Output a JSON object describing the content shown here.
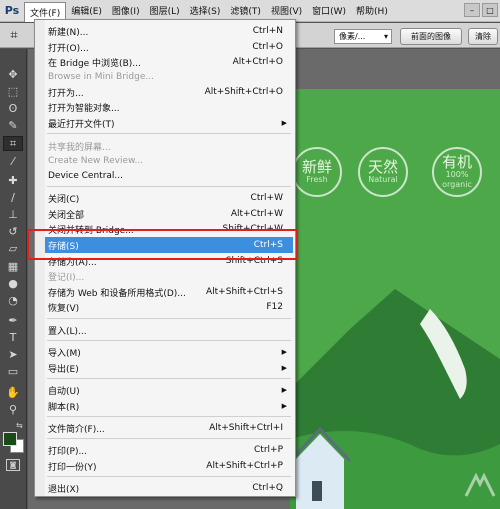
{
  "menubar": {
    "logo": "Ps",
    "items": [
      "文件(F)",
      "编辑(E)",
      "图像(I)",
      "图层(L)",
      "选择(S)",
      "滤镜(T)",
      "视图(V)",
      "窗口(W)",
      "帮助(H)"
    ],
    "active_index": 0
  },
  "options_bar": {
    "unit_value": "像素/...",
    "front_image_label": "前面的图像",
    "clear_label": "清除"
  },
  "file_menu": {
    "items": [
      {
        "label": "新建(N)...",
        "shortcut": "Ctrl+N",
        "enabled": true
      },
      {
        "label": "打开(O)...",
        "shortcut": "Ctrl+O",
        "enabled": true
      },
      {
        "label": "在 Bridge 中浏览(B)...",
        "shortcut": "Alt+Ctrl+O",
        "enabled": true
      },
      {
        "label": "Browse in Mini Bridge...",
        "shortcut": "",
        "enabled": false
      },
      {
        "label": "打开为...",
        "shortcut": "Alt+Shift+Ctrl+O",
        "enabled": true
      },
      {
        "label": "打开为智能对象...",
        "shortcut": "",
        "enabled": true
      },
      {
        "label": "最近打开文件(T)",
        "shortcut": "",
        "enabled": true,
        "submenu": true
      },
      {
        "label": "共享我的屏幕...",
        "shortcut": "",
        "enabled": false
      },
      {
        "label": "Create New Review...",
        "shortcut": "",
        "enabled": false
      },
      {
        "label": "Device Central...",
        "shortcut": "",
        "enabled": true
      },
      {
        "label": "关闭(C)",
        "shortcut": "Ctrl+W",
        "enabled": true
      },
      {
        "label": "关闭全部",
        "shortcut": "Alt+Ctrl+W",
        "enabled": true
      },
      {
        "label": "关闭并转到 Bridge...",
        "shortcut": "Shift+Ctrl+W",
        "enabled": true
      },
      {
        "label": "存储(S)",
        "shortcut": "Ctrl+S",
        "enabled": true,
        "highlighted": true
      },
      {
        "label": "存储为(A)...",
        "shortcut": "Shift+Ctrl+S",
        "enabled": true
      },
      {
        "label": "登记(I)...",
        "shortcut": "",
        "enabled": false
      },
      {
        "label": "存储为 Web 和设备所用格式(D)...",
        "shortcut": "Alt+Shift+Ctrl+S",
        "enabled": true
      },
      {
        "label": "恢复(V)",
        "shortcut": "F12",
        "enabled": true
      },
      {
        "label": "置入(L)...",
        "shortcut": "",
        "enabled": true
      },
      {
        "label": "导入(M)",
        "shortcut": "",
        "enabled": true,
        "submenu": true
      },
      {
        "label": "导出(E)",
        "shortcut": "",
        "enabled": true,
        "submenu": true
      },
      {
        "label": "自动(U)",
        "shortcut": "",
        "enabled": true,
        "submenu": true
      },
      {
        "label": "脚本(R)",
        "shortcut": "",
        "enabled": true,
        "submenu": true
      },
      {
        "label": "文件简介(F)...",
        "shortcut": "Alt+Shift+Ctrl+I",
        "enabled": true
      },
      {
        "label": "打印(P)...",
        "shortcut": "Ctrl+P",
        "enabled": true
      },
      {
        "label": "打印一份(Y)",
        "shortcut": "Alt+Shift+Ctrl+P",
        "enabled": true
      },
      {
        "label": "退出(X)",
        "shortcut": "Ctrl+Q",
        "enabled": true
      }
    ]
  },
  "artwork": {
    "badges": [
      {
        "big": "新鲜",
        "small": "Fresh"
      },
      {
        "big": "天然",
        "small": "Natural"
      },
      {
        "big": "有机",
        "small": "organic"
      }
    ],
    "badge_sub": "100%"
  },
  "colors": {
    "foreground": "#1a4a1a",
    "background": "#ffffff",
    "highlight": "#3b8fde",
    "annotation": "#e02020"
  }
}
